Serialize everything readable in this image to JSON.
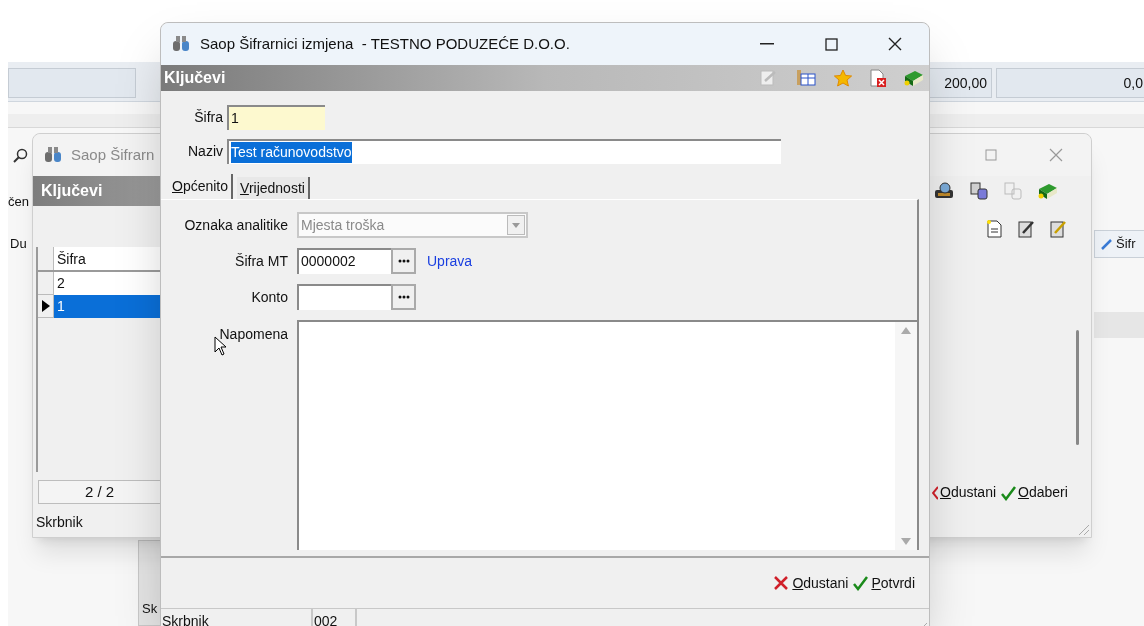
{
  "background_app": {
    "fields": [
      {
        "value": "200,00"
      },
      {
        "value": "0,0"
      }
    ],
    "cut_labels": [
      "čen",
      "Du"
    ],
    "column_header": "Šifr",
    "status_label": "Sk"
  },
  "list_window": {
    "title": "Saop Šifrarn",
    "header": "Ključevi",
    "column": "Šifra",
    "rows": [
      {
        "value": "2",
        "selected": false
      },
      {
        "value": "1",
        "selected": true
      }
    ],
    "record_count": "2 / 2",
    "status": "Skrbnik",
    "buttons": [
      {
        "label": "Odustani",
        "kind": "cancel"
      },
      {
        "label": "Odaberi",
        "kind": "ok"
      }
    ]
  },
  "edit_window": {
    "title": "Saop Šifrarnici izmjena  - TESTNO PODUZEĆE D.O.O.",
    "header": "Ključevi",
    "top_fields": [
      {
        "label": "Šifra",
        "value": "1",
        "kind": "key",
        "selected": false
      },
      {
        "label": "Naziv",
        "value": "Test računovodstvo",
        "kind": "text",
        "selected": true
      }
    ],
    "tabs": [
      {
        "label": "Općenito",
        "selected": true
      },
      {
        "label": "Vrijednosti",
        "selected": false
      }
    ],
    "form": [
      {
        "label": "Oznaka analitike",
        "kind": "dropdown",
        "value": "Mjesta troška",
        "disabled": true
      },
      {
        "label": "Šifra MT",
        "kind": "lookup",
        "value": "0000002",
        "link": "Uprava"
      },
      {
        "label": "Konto",
        "kind": "lookup"
      },
      {
        "label": "Napomena",
        "kind": "memo"
      }
    ],
    "buttons": [
      {
        "label": "Odustani",
        "kind": "cancel"
      },
      {
        "label": "Potvrdi",
        "kind": "ok"
      }
    ],
    "status_bar": [
      "Skrbnik",
      "002"
    ]
  }
}
